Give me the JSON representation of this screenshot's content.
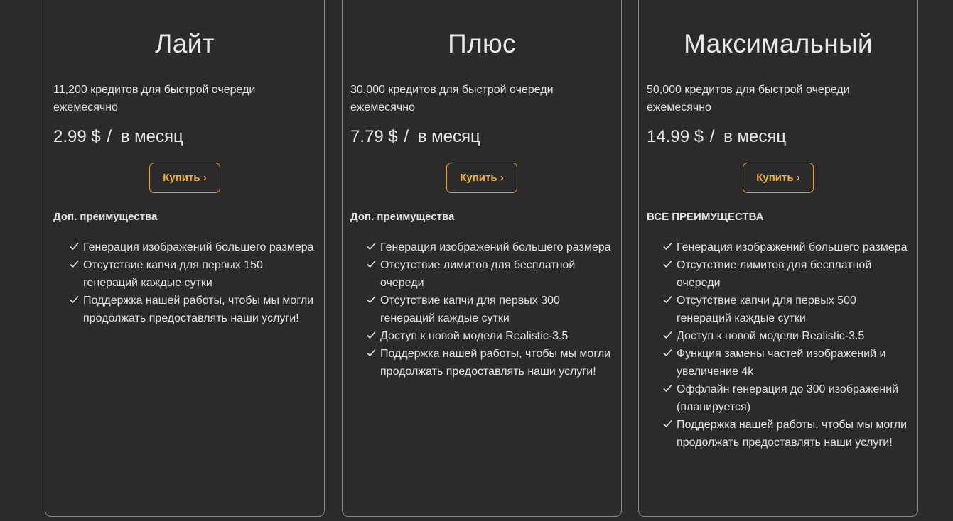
{
  "plans": [
    {
      "name": "Лайт",
      "credits": "11,200 кредитов для быстрой очереди ежемесячно",
      "price": "2.99 $",
      "price_sep": "/",
      "period": "в месяц",
      "buy_label": "Купить ›",
      "benefits_title": "Доп. преимущества",
      "features": [
        "Генерация изображений большего размера",
        "Отсутствие капчи для первых 150 генераций каждые сутки",
        "Поддержка нашей работы, чтобы мы могли продолжать предоставлять наши услуги!"
      ]
    },
    {
      "name": "Плюс",
      "credits": "30,000 кредитов для быстрой очереди ежемесячно",
      "price": "7.79 $",
      "price_sep": "/",
      "period": "в месяц",
      "buy_label": "Купить ›",
      "benefits_title": "Доп. преимущества",
      "features": [
        "Генерация изображений большего размера",
        "Отсутствие лимитов для бесплатной очереди",
        "Отсутствие капчи для первых 300 генераций каждые сутки",
        "Доступ к новой модели Realistic-3.5",
        "Поддержка нашей работы, чтобы мы могли продолжать предоставлять наши услуги!"
      ]
    },
    {
      "name": "Максимальный",
      "credits": "50,000 кредитов для быстрой очереди ежемесячно",
      "price": "14.99 $",
      "price_sep": "/",
      "period": "в месяц",
      "buy_label": "Купить ›",
      "benefits_title": "ВСЕ ПРЕИМУЩЕСТВА",
      "features": [
        "Генерация изображений большего размера",
        "Отсутствие лимитов для бесплатной очереди",
        "Отсутствие капчи для первых 500 генераций каждые сутки",
        "Доступ к новой модели Realistic-3.5",
        "Функция замены частей изображений и увеличение 4k",
        "Оффлайн генерация до 300 изображений (планируется)",
        "Поддержка нашей работы, чтобы мы могли продолжать предоставлять наши услуги!"
      ]
    }
  ],
  "colors": {
    "background": "#2b2b2b",
    "accent": "#f2b43e",
    "border": "#8a8a8a"
  },
  "icons": {
    "feature_marker": "check-icon"
  }
}
